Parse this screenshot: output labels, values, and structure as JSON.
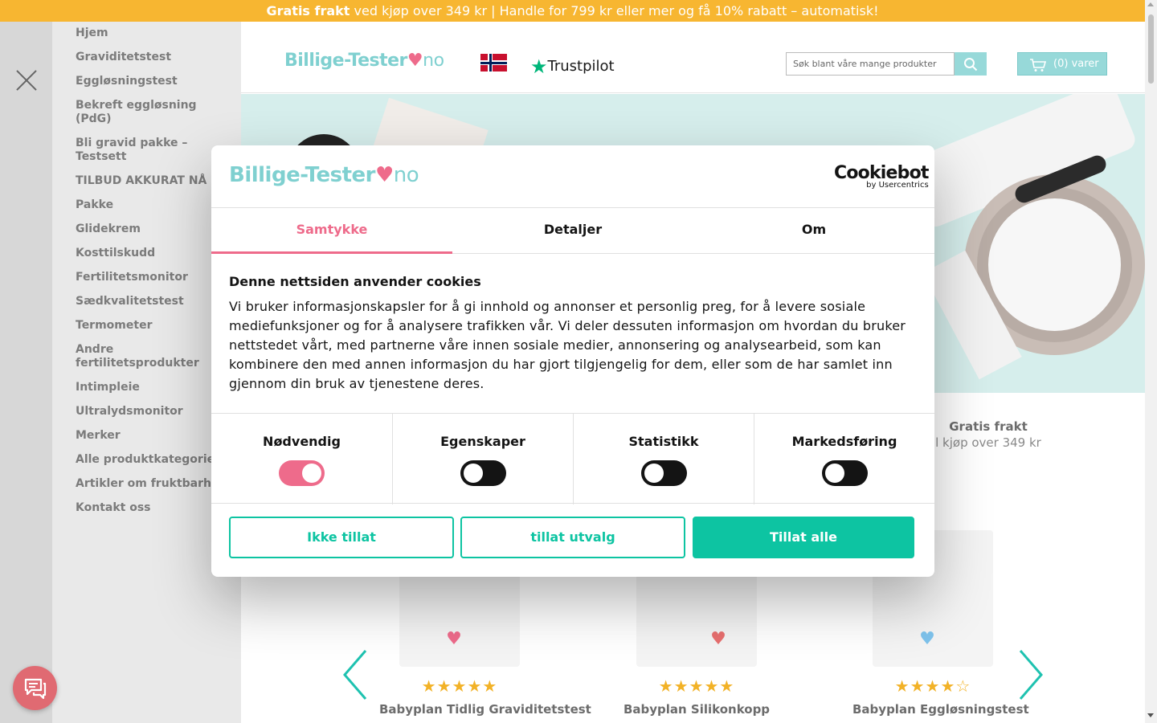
{
  "promo": {
    "bold": "Gratis frakt",
    "text": " ved kjøp over 349 kr | Handle for 799 kr eller mer og få 10% rabatt – automatisk!"
  },
  "sidebar": {
    "items": [
      {
        "label": "Hjem"
      },
      {
        "label": "Graviditetstest"
      },
      {
        "label": "Eggløsningstest"
      },
      {
        "label": "Bekreft eggløsning (PdG)"
      },
      {
        "label": "Bli gravid pakke – Testsett"
      },
      {
        "label": "TILBUD AKKURAT NÅ"
      },
      {
        "label": "Pakke"
      },
      {
        "label": "Glidekrem"
      },
      {
        "label": "Kosttilskudd"
      },
      {
        "label": "Fertilitetsmonitor"
      },
      {
        "label": "Sædkvalitetstest"
      },
      {
        "label": "Termometer"
      },
      {
        "label": "Andre fertilitetsprodukter"
      },
      {
        "label": "Intimpleie"
      },
      {
        "label": "Ultralydsmonitor"
      },
      {
        "label": "Merker"
      },
      {
        "label": "Alle produktkategorier"
      },
      {
        "label": "Artikler om fruktbarhet"
      },
      {
        "label": "Kontakt oss"
      }
    ]
  },
  "header": {
    "logo_main": "Billige-Tester",
    "logo_heart": "♥",
    "logo_tld": "no",
    "trustpilot": "Trustpilot",
    "search_placeholder": "Søk blant våre mange produkter",
    "cart_label": "(0) varer"
  },
  "usp": {
    "title": "Gratis frakt",
    "subtitle": "l kjøp over 349 kr"
  },
  "products": [
    {
      "name": "Babyplan Tidlig Graviditetstest",
      "rating": 5
    },
    {
      "name": "Babyplan Silikonkopp",
      "rating": 5
    },
    {
      "name": "Babyplan Eggløsningstest",
      "rating": 4
    }
  ],
  "cookie": {
    "logo_main": "Billige-Tester",
    "logo_heart": "♥",
    "logo_tld": "no",
    "brand": "Cookiebot",
    "brand_sub": "by Usercentrics",
    "tabs": [
      {
        "label": "Samtykke",
        "active": true
      },
      {
        "label": "Detaljer",
        "active": false
      },
      {
        "label": "Om",
        "active": false
      }
    ],
    "title": "Denne nettsiden anvender cookies",
    "body": "Vi bruker informasjonskapsler for å gi innhold og annonser et personlig preg, for å levere sosiale mediefunksjoner og for å analysere trafikken vår. Vi deler dessuten informasjon om hvordan du bruker nettstedet vårt, med partnerne våre innen sosiale medier, annonsering og analysearbeid, som kan kombinere den med annen informasjon du har gjort tilgjengelig for dem, eller som de har samlet inn gjennom din bruk av tjenestene deres.",
    "toggles": [
      {
        "label": "Nødvendig",
        "on": true
      },
      {
        "label": "Egenskaper",
        "on": false
      },
      {
        "label": "Statistikk",
        "on": false
      },
      {
        "label": "Markedsføring",
        "on": false
      }
    ],
    "buttons": {
      "deny": "Ikke tillat",
      "selection": "tillat utvalg",
      "allow_all": "Tillat alle"
    }
  },
  "colors": {
    "promo": "#f7b631",
    "brand_teal": "#7fd0d0",
    "accent_pink": "#ee6b8b",
    "cta_green": "#0dc4a2",
    "chat": "#e06a72"
  }
}
